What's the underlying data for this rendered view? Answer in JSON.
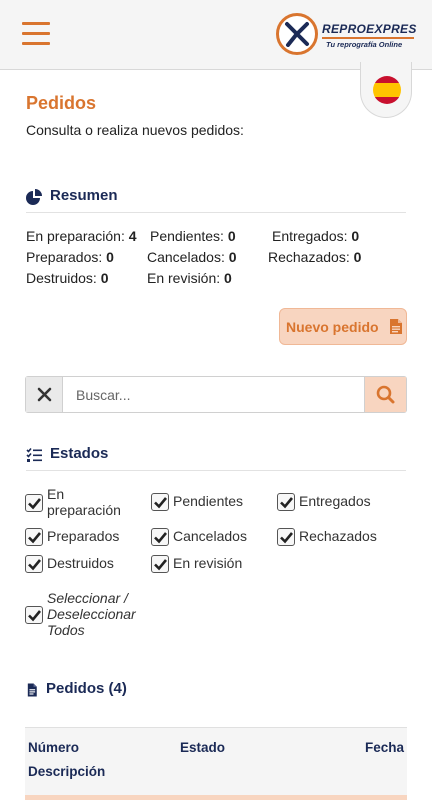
{
  "header": {
    "logo_name": "REPROEXPRES",
    "logo_tagline": "Tu reprografía Online",
    "menu_icon": "hamburger-menu-icon",
    "language_flag": "spain-flag-icon"
  },
  "page": {
    "title": "Pedidos",
    "subtitle": "Consulta o realiza nuevos pedidos:"
  },
  "resumen": {
    "heading": "Resumen",
    "icon": "pie-chart-icon",
    "stats": [
      {
        "label": "En preparación:",
        "value": "4"
      },
      {
        "label": "Pendientes:",
        "value": "0"
      },
      {
        "label": "Entregados:",
        "value": "0"
      },
      {
        "label": "Preparados:",
        "value": "0"
      },
      {
        "label": "Cancelados:",
        "value": "0"
      },
      {
        "label": "Rechazados:",
        "value": "0"
      },
      {
        "label": "Destruidos:",
        "value": "0"
      },
      {
        "label": "En revisión:",
        "value": "0"
      }
    ]
  },
  "new_order": {
    "label": "Nuevo pedido",
    "icon": "document-icon"
  },
  "search": {
    "placeholder": "Buscar...",
    "value": "",
    "clear_icon": "close-icon",
    "search_icon": "search-icon"
  },
  "estados": {
    "heading": "Estados",
    "icon": "checklist-icon",
    "options": [
      {
        "line1": "En",
        "line2": "preparación",
        "checked": true
      },
      {
        "label": "Pendientes",
        "checked": true
      },
      {
        "label": "Entregados",
        "checked": true
      },
      {
        "label": "Preparados",
        "checked": true
      },
      {
        "label": "Cancelados",
        "checked": true
      },
      {
        "label": "Rechazados",
        "checked": true
      },
      {
        "label": "Destruidos",
        "checked": true
      },
      {
        "label": "En revisión",
        "checked": true
      }
    ],
    "select_all": {
      "line1": "Seleccionar /",
      "line2": "Deseleccionar",
      "line3": "Todos",
      "checked": true
    }
  },
  "pedidos": {
    "heading": "Pedidos (4)",
    "icon": "file-text-icon",
    "columns": {
      "numero": "Número",
      "estado": "Estado",
      "fecha": "Fecha",
      "descripcion": "Descripción"
    }
  },
  "colors": {
    "accent": "#d9752f",
    "accent_light": "#f8d5c0",
    "navy": "#1b2a56"
  }
}
